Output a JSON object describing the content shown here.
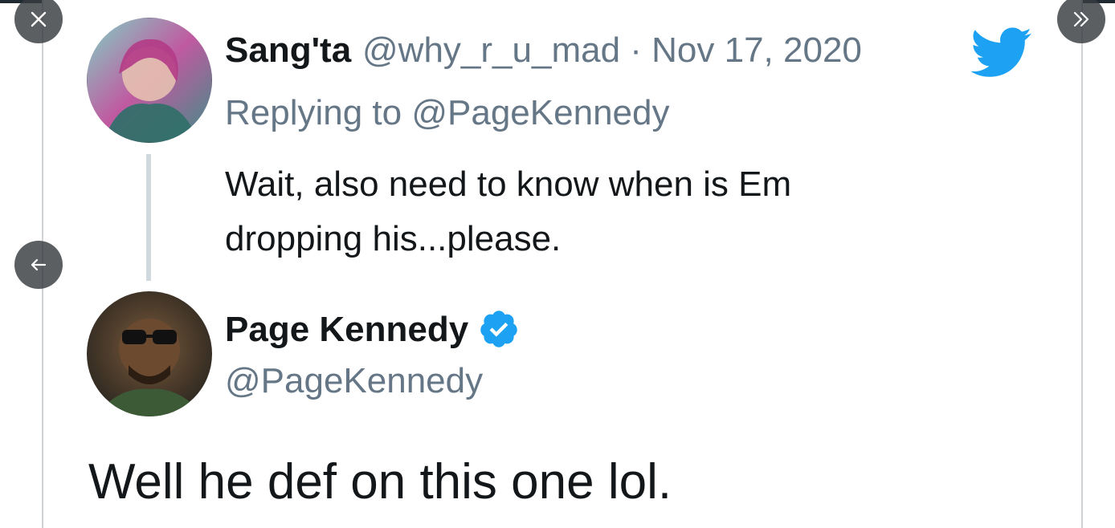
{
  "controls": {
    "close_icon": "close-icon",
    "next_icon": "double-chevron-right-icon",
    "back_icon": "arrow-left-icon"
  },
  "reply_tweet": {
    "display_name": "Sang'ta",
    "meta": "@why_r_u_mad · Nov 17, 2020",
    "replying_to": "Replying to @PageKennedy",
    "text_line1": "Wait, also need to know when is Em",
    "text_line2": "dropping his...please."
  },
  "main_tweet": {
    "display_name": "Page Kennedy",
    "handle": "@PageKennedy",
    "text": "Well he def on this one lol."
  },
  "colors": {
    "twitter_blue": "#1da1f2",
    "text_primary": "#14171a",
    "text_secondary": "#657786"
  }
}
